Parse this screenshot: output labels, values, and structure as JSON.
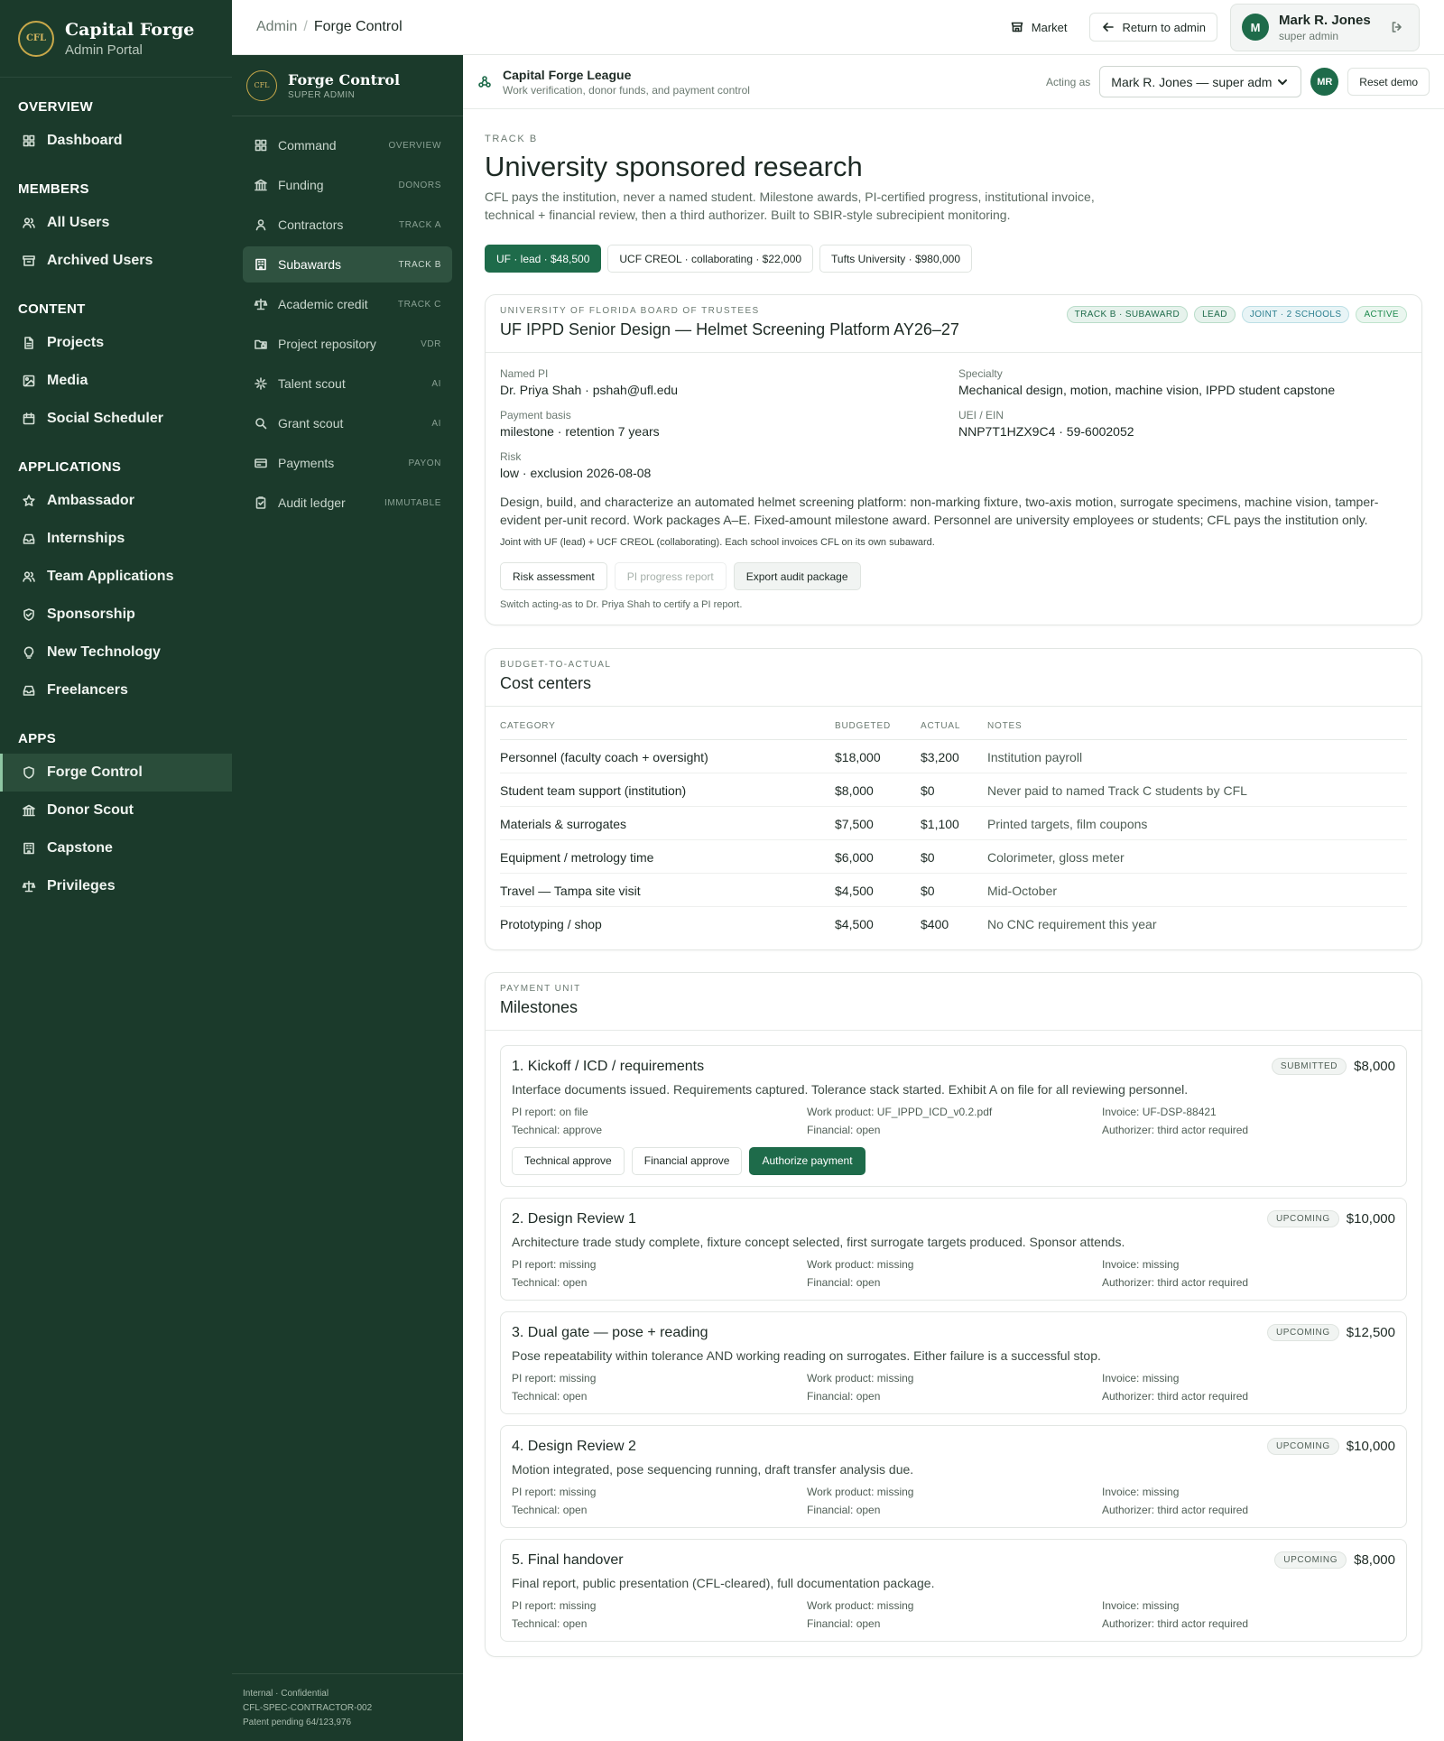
{
  "admin": {
    "brand_title": "Capital Forge",
    "brand_sub": "Admin Portal",
    "logo_text": "CFL",
    "sections": [
      {
        "title": "OVERVIEW",
        "items": [
          {
            "label": "Dashboard",
            "icon": "dashboard-icon"
          }
        ]
      },
      {
        "title": "MEMBERS",
        "items": [
          {
            "label": "All Users",
            "icon": "users-icon"
          },
          {
            "label": "Archived Users",
            "icon": "archive-icon"
          }
        ]
      },
      {
        "title": "CONTENT",
        "items": [
          {
            "label": "Projects",
            "icon": "file-icon"
          },
          {
            "label": "Media",
            "icon": "image-icon"
          },
          {
            "label": "Social Scheduler",
            "icon": "calendar-icon"
          }
        ]
      },
      {
        "title": "APPLICATIONS",
        "items": [
          {
            "label": "Ambassador",
            "icon": "star-icon"
          },
          {
            "label": "Internships",
            "icon": "inbox-icon"
          },
          {
            "label": "Team Applications",
            "icon": "users-icon"
          },
          {
            "label": "Sponsorship",
            "icon": "badge-icon"
          },
          {
            "label": "New Technology",
            "icon": "lightbulb-icon"
          },
          {
            "label": "Freelancers",
            "icon": "inbox-icon"
          }
        ]
      },
      {
        "title": "APPS",
        "items": [
          {
            "label": "Forge Control",
            "icon": "shield-icon"
          },
          {
            "label": "Donor Scout",
            "icon": "bank-icon"
          },
          {
            "label": "Capstone",
            "icon": "building-icon"
          },
          {
            "label": "Privileges",
            "icon": "scale-icon"
          }
        ]
      }
    ]
  },
  "topbar": {
    "crumb_root": "Admin",
    "crumb_current": "Forge Control",
    "market": "Market",
    "return": "Return to admin",
    "user_initial": "M",
    "user_name": "Mark R. Jones",
    "user_role": "super admin"
  },
  "forge": {
    "logo_text": "CFL",
    "title": "Forge Control",
    "sub": "SUPER ADMIN",
    "items": [
      {
        "label": "Command",
        "tag": "OVERVIEW",
        "icon": "grid-icon"
      },
      {
        "label": "Funding",
        "tag": "DONORS",
        "icon": "bank-icon"
      },
      {
        "label": "Contractors",
        "tag": "TRACK A",
        "icon": "user-icon"
      },
      {
        "label": "Subawards",
        "tag": "TRACK B",
        "icon": "building-icon"
      },
      {
        "label": "Academic credit",
        "tag": "TRACK C",
        "icon": "scale-icon"
      },
      {
        "label": "Project repository",
        "tag": "VDR",
        "icon": "folder-lock-icon"
      },
      {
        "label": "Talent scout",
        "tag": "AI",
        "icon": "sparkle-icon"
      },
      {
        "label": "Grant scout",
        "tag": "AI",
        "icon": "search-icon"
      },
      {
        "label": "Payments",
        "tag": "PAYON",
        "icon": "card-icon"
      },
      {
        "label": "Audit ledger",
        "tag": "IMMUTABLE",
        "icon": "clipboard-icon"
      }
    ],
    "footer": [
      "Internal · Confidential",
      "CFL-SPEC-CONTRACTOR-002",
      "Patent pending 64/123,976"
    ]
  },
  "context": {
    "title": "Capital Forge League",
    "sub": "Work verification, donor funds, and payment control",
    "acting_label": "Acting as",
    "acting_value": "Mark R. Jones — super adm",
    "avatar": "MR",
    "reset": "Reset demo"
  },
  "page": {
    "eyebrow": "TRACK B",
    "title": "University sponsored research",
    "lead": "CFL pays the institution, never a named student. Milestone awards, PI-certified progress, institutional invoice, technical + financial review, then a third authorizer. Built to SBIR-style subrecipient monitoring.",
    "chips": [
      "UF · lead · $48,500",
      "UCF CREOL · collaborating · $22,000",
      "Tufts University · $980,000"
    ]
  },
  "award": {
    "eyebrow": "UNIVERSITY OF FLORIDA BOARD OF TRUSTEES",
    "title": "UF IPPD Senior Design — Helmet Screening Platform AY26–27",
    "badges": [
      "TRACK B · SUBAWARD",
      "LEAD",
      "JOINT · 2 SCHOOLS",
      "ACTIVE"
    ],
    "fields": [
      {
        "label": "Named PI",
        "value": "Dr. Priya Shah · pshah@ufl.edu"
      },
      {
        "label": "Specialty",
        "value": "Mechanical design, motion, machine vision, IPPD student capstone"
      },
      {
        "label": "Payment basis",
        "value": "milestone · retention 7 years"
      },
      {
        "label": "UEI / EIN",
        "value": "NNP7T1HZX9C4 · 59-6002052"
      },
      {
        "label": "Risk",
        "value": "low · exclusion 2026-08-08"
      }
    ],
    "description": "Design, build, and characterize an automated helmet screening platform: non-marking fixture, two-axis motion, surrogate specimens, machine vision, tamper-evident per-unit record. Work packages A–E. Fixed-amount milestone award. Personnel are university employees or students; CFL pays the institution only.",
    "joint_note": "Joint with UF (lead) + UCF CREOL (collaborating). Each school invoices CFL on its own subaward.",
    "buttons": [
      "Risk assessment",
      "PI progress report",
      "Export audit package"
    ],
    "hint": "Switch acting-as to Dr. Priya Shah to certify a PI report."
  },
  "budget": {
    "eyebrow": "BUDGET-TO-ACTUAL",
    "title": "Cost centers",
    "headers": [
      "CATEGORY",
      "BUDGETED",
      "ACTUAL",
      "NOTES"
    ],
    "rows": [
      [
        "Personnel (faculty coach + oversight)",
        "$18,000",
        "$3,200",
        "Institution payroll"
      ],
      [
        "Student team support (institution)",
        "$8,000",
        "$0",
        "Never paid to named Track C students by CFL"
      ],
      [
        "Materials & surrogates",
        "$7,500",
        "$1,100",
        "Printed targets, film coupons"
      ],
      [
        "Equipment / metrology time",
        "$6,000",
        "$0",
        "Colorimeter, gloss meter"
      ],
      [
        "Travel — Tampa site visit",
        "$4,500",
        "$0",
        "Mid-October"
      ],
      [
        "Prototyping / shop",
        "$4,500",
        "$400",
        "No CNC requirement this year"
      ]
    ]
  },
  "milestones": {
    "eyebrow": "PAYMENT UNIT",
    "title": "Milestones",
    "action_labels": [
      "Technical approve",
      "Financial approve",
      "Authorize payment"
    ],
    "items": [
      {
        "title": "1. Kickoff / ICD / requirements",
        "status": "SUBMITTED",
        "amount": "$8,000",
        "desc": "Interface documents issued. Requirements captured. Tolerance stack started. Exhibit A on file for all reviewing personnel.",
        "pi": "PI report: on file",
        "work": "Work product: UF_IPPD_ICD_v0.2.pdf",
        "invoice": "Invoice: UF-DSP-88421",
        "tech": "Technical: approve",
        "fin": "Financial: open",
        "auth": "Authorizer: third actor required"
      },
      {
        "title": "2. Design Review 1",
        "status": "UPCOMING",
        "amount": "$10,000",
        "desc": "Architecture trade study complete, fixture concept selected, first surrogate targets produced. Sponsor attends.",
        "pi": "PI report: missing",
        "work": "Work product: missing",
        "invoice": "Invoice: missing",
        "tech": "Technical: open",
        "fin": "Financial: open",
        "auth": "Authorizer: third actor required"
      },
      {
        "title": "3. Dual gate — pose + reading",
        "status": "UPCOMING",
        "amount": "$12,500",
        "desc": "Pose repeatability within tolerance AND working reading on surrogates. Either failure is a successful stop.",
        "pi": "PI report: missing",
        "work": "Work product: missing",
        "invoice": "Invoice: missing",
        "tech": "Technical: open",
        "fin": "Financial: open",
        "auth": "Authorizer: third actor required"
      },
      {
        "title": "4. Design Review 2",
        "status": "UPCOMING",
        "amount": "$10,000",
        "desc": "Motion integrated, pose sequencing running, draft transfer analysis due.",
        "pi": "PI report: missing",
        "work": "Work product: missing",
        "invoice": "Invoice: missing",
        "tech": "Technical: open",
        "fin": "Financial: open",
        "auth": "Authorizer: third actor required"
      },
      {
        "title": "5. Final handover",
        "status": "UPCOMING",
        "amount": "$8,000",
        "desc": "Final report, public presentation (CFL-cleared), full documentation package.",
        "pi": "PI report: missing",
        "work": "Work product: missing",
        "invoice": "Invoice: missing",
        "tech": "Technical: open",
        "fin": "Financial: open",
        "auth": "Authorizer: third actor required"
      }
    ]
  },
  "colors": {
    "brand_dark": "#1b3a2b",
    "accent": "#1e6b4a",
    "gold": "#c8a84a"
  }
}
